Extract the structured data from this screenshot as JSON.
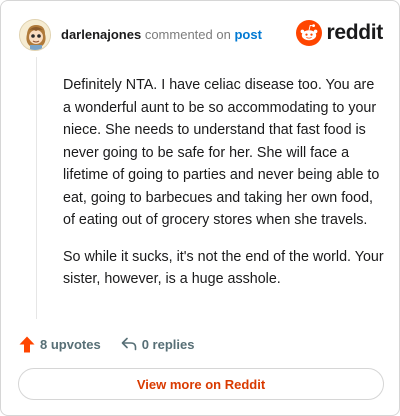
{
  "comment": {
    "username": "darlenajones",
    "action_text": "commented on",
    "post_link_label": "post",
    "paragraphs": [
      "Definitely NTA. I have celiac disease too. You are a wonderful aunt to be so accommodating to your niece. She needs to understand that fast food is never going to be safe for her. She will face a lifetime of going to parties and never being able to eat, going to barbecues and taking her own food, of eating out of grocery stores when she travels.",
      "So while it sucks, it's not the end of the world. Your sister, however, is a huge asshole."
    ],
    "upvotes_label": "8 upvotes",
    "replies_label": "0 replies"
  },
  "brand": {
    "name": "reddit",
    "logo_icon": "reddit-snoo-icon",
    "accent_color": "#ff4500"
  },
  "footer": {
    "view_more_label": "View more on Reddit",
    "link_color": "#d93a00"
  }
}
